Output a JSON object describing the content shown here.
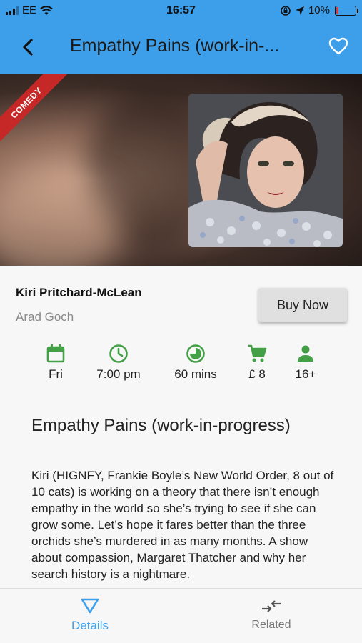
{
  "status_bar": {
    "carrier": "EE",
    "time": "16:57",
    "battery_percent": "10%"
  },
  "app_bar": {
    "title": "Empathy Pains (work-in-..."
  },
  "hero": {
    "category_ribbon": "COMEDY"
  },
  "event": {
    "performer": "Kiri Pritchard-McLean",
    "venue": "Arad Goch",
    "buy_label": "Buy Now"
  },
  "facts": [
    {
      "icon": "calendar-icon",
      "label": "Fri"
    },
    {
      "icon": "clock-icon",
      "label": "7:00 pm"
    },
    {
      "icon": "duration-icon",
      "label": "60 mins"
    },
    {
      "icon": "cart-icon",
      "label": "£ 8"
    },
    {
      "icon": "person-icon",
      "label": "16+"
    }
  ],
  "description": {
    "title": "Empathy Pains (work-in-progress)",
    "body": "Kiri (HIGNFY, Frankie Boyle’s New World Order, 8 out of 10 cats) is working on a theory that there isn’t enough empathy in the world so she’s trying to see if she can grow some. Let’s hope it fares better than the three orchids she’s murdered in as many months. A show about compassion, Margaret Thatcher and why her search history is a nightmare."
  },
  "bottom_nav": {
    "items": [
      {
        "label": "Details",
        "icon": "triangle-icon",
        "active": true
      },
      {
        "label": "Related",
        "icon": "compare-arrows-icon",
        "active": false
      }
    ]
  },
  "colors": {
    "primary": "#3d9ee9",
    "fact_icon": "#43a047",
    "ribbon": "#c62828"
  }
}
